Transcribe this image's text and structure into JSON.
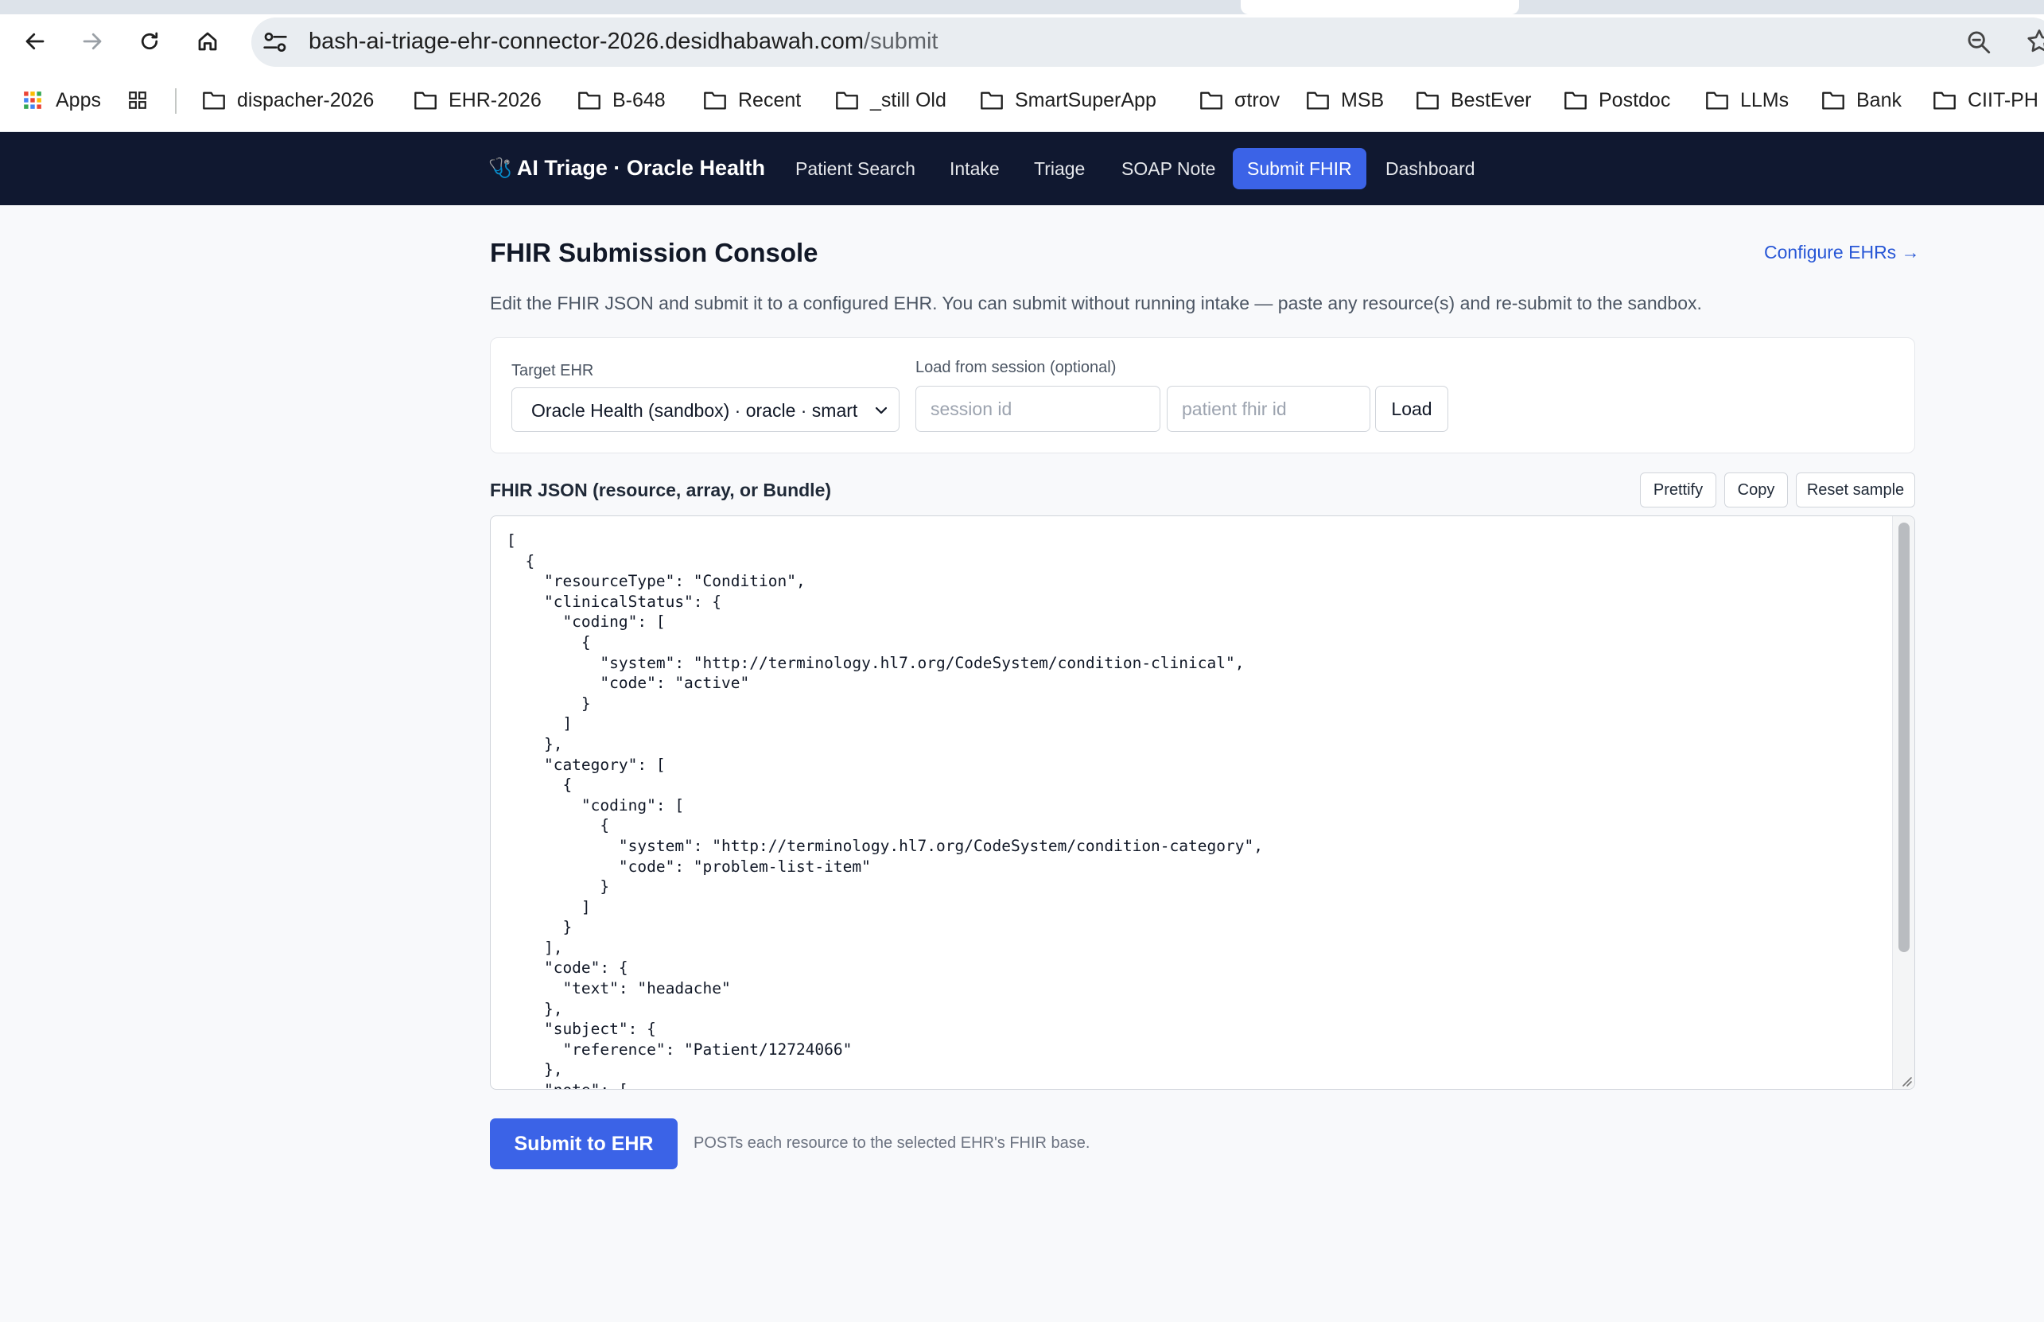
{
  "browser": {
    "url_host": "bash-ai-triage-ehr-connector-2026.desidhabawah.com",
    "url_path": "/submit",
    "bookmarks": [
      {
        "label": "Apps",
        "icon": "apps-grid-icon"
      },
      {
        "label": "dispacher-2026",
        "icon": "folder-icon"
      },
      {
        "label": "EHR-2026",
        "icon": "folder-icon"
      },
      {
        "label": "B-648",
        "icon": "folder-icon"
      },
      {
        "label": "Recent",
        "icon": "folder-icon"
      },
      {
        "label": "_still Old",
        "icon": "folder-icon"
      },
      {
        "label": "SmartSuperApp",
        "icon": "folder-icon"
      },
      {
        "label": "σtrov",
        "icon": "folder-icon"
      },
      {
        "label": "MSB",
        "icon": "folder-icon"
      },
      {
        "label": "BestEver",
        "icon": "folder-icon"
      },
      {
        "label": "Postdoc",
        "icon": "folder-icon"
      },
      {
        "label": "LLMs",
        "icon": "folder-icon"
      },
      {
        "label": "Bank",
        "icon": "folder-icon"
      },
      {
        "label": "CIIT-PH",
        "icon": "folder-icon"
      }
    ]
  },
  "nav": {
    "brand_icon": "stethoscope-icon",
    "brand": "AI Triage · Oracle Health",
    "items": [
      {
        "label": "Patient Search",
        "active": false
      },
      {
        "label": "Intake",
        "active": false
      },
      {
        "label": "Triage",
        "active": false
      },
      {
        "label": "SOAP Note",
        "active": false
      },
      {
        "label": "Submit FHIR",
        "active": true
      },
      {
        "label": "Dashboard",
        "active": false
      }
    ],
    "accent": "#3b63e7",
    "background": "#101830"
  },
  "main": {
    "title": "FHIR Submission Console",
    "config_link": "Configure EHRs →",
    "description": "Edit the FHIR JSON and submit it to a configured EHR. You can submit without running intake — paste any resource(s) and re-submit to the sandbox."
  },
  "form": {
    "target_label": "Target EHR",
    "target_value": "Oracle Health (sandbox) · oracle · smart",
    "session_label": "Load from session (optional)",
    "session_placeholder": "session id",
    "patient_placeholder": "patient fhir id",
    "load_button": "Load"
  },
  "editor": {
    "label": "FHIR JSON (resource, array, or Bundle)",
    "buttons": {
      "prettify": "Prettify",
      "copy": "Copy",
      "reset": "Reset sample"
    },
    "content": "[\n  {\n    \"resourceType\": \"Condition\",\n    \"clinicalStatus\": {\n      \"coding\": [\n        {\n          \"system\": \"http://terminology.hl7.org/CodeSystem/condition-clinical\",\n          \"code\": \"active\"\n        }\n      ]\n    },\n    \"category\": [\n      {\n        \"coding\": [\n          {\n            \"system\": \"http://terminology.hl7.org/CodeSystem/condition-category\",\n            \"code\": \"problem-list-item\"\n          }\n        ]\n      }\n    ],\n    \"code\": {\n      \"text\": \"headache\"\n    },\n    \"subject\": {\n      \"reference\": \"Patient/12724066\"\n    },\n    \"note\": ["
  },
  "submit": {
    "button": "Submit to EHR",
    "hint": "POSTs each resource to the selected EHR's FHIR base."
  }
}
